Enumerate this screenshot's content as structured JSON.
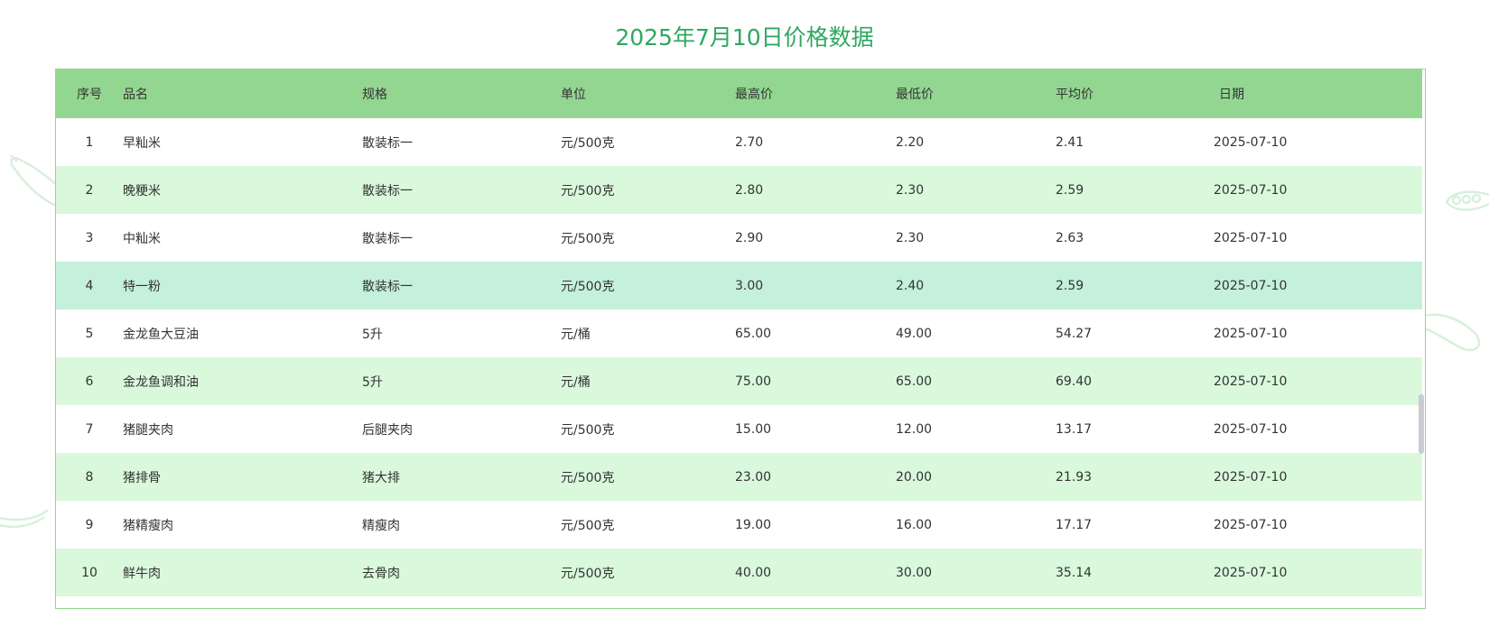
{
  "page": {
    "title": "2025年7月10日价格数据"
  },
  "table": {
    "columns": [
      "序号",
      "品名",
      "规格",
      "单位",
      "最高价",
      "最低价",
      "平均价",
      "日期"
    ],
    "rows": [
      [
        "1",
        "早籼米",
        "散装标一",
        "元/500克",
        "2.70",
        "2.20",
        "2.41",
        "2025-07-10"
      ],
      [
        "2",
        "晚粳米",
        "散装标一",
        "元/500克",
        "2.80",
        "2.30",
        "2.59",
        "2025-07-10"
      ],
      [
        "3",
        "中籼米",
        "散装标一",
        "元/500克",
        "2.90",
        "2.30",
        "2.63",
        "2025-07-10"
      ],
      [
        "4",
        "特一粉",
        "散装标一",
        "元/500克",
        "3.00",
        "2.40",
        "2.59",
        "2025-07-10"
      ],
      [
        "5",
        "金龙鱼大豆油",
        "5升",
        "元/桶",
        "65.00",
        "49.00",
        "54.27",
        "2025-07-10"
      ],
      [
        "6",
        "金龙鱼调和油",
        "5升",
        "元/桶",
        "75.00",
        "65.00",
        "69.40",
        "2025-07-10"
      ],
      [
        "7",
        "猪腿夹肉",
        "后腿夹肉",
        "元/500克",
        "15.00",
        "12.00",
        "13.17",
        "2025-07-10"
      ],
      [
        "8",
        "猪排骨",
        "猪大排",
        "元/500克",
        "23.00",
        "20.00",
        "21.93",
        "2025-07-10"
      ],
      [
        "9",
        "猪精瘦肉",
        "精瘦肉",
        "元/500克",
        "19.00",
        "16.00",
        "17.17",
        "2025-07-10"
      ],
      [
        "10",
        "鲜牛肉",
        "去骨肉",
        "元/500克",
        "40.00",
        "30.00",
        "35.14",
        "2025-07-10"
      ]
    ],
    "hovered_row_index": 3
  },
  "colors": {
    "title": "#2fa760",
    "header_bg": "#93d691",
    "stripe_bg": "#d9f8dc",
    "hover_bg": "#c4f0dc",
    "border": "#93d691"
  },
  "decorations": [
    "eggplant-icon",
    "pea-pod-icon",
    "chili-pepper-icon"
  ]
}
